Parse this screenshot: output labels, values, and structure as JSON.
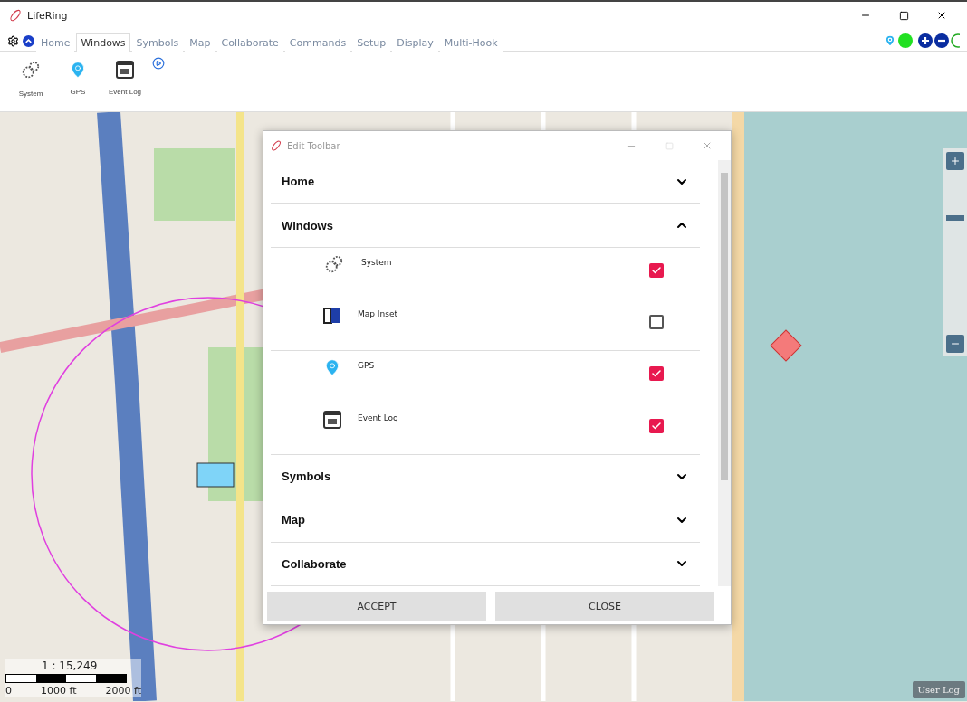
{
  "window": {
    "title": "LifeRing"
  },
  "tabs": [
    {
      "label": "Home",
      "selected": false
    },
    {
      "label": "Windows",
      "selected": true
    },
    {
      "label": "Symbols",
      "selected": false
    },
    {
      "label": "Map",
      "selected": false
    },
    {
      "label": "Collaborate",
      "selected": false
    },
    {
      "label": "Commands",
      "selected": false
    },
    {
      "label": "Setup",
      "selected": false
    },
    {
      "label": "Display",
      "selected": false
    },
    {
      "label": "Multi-Hook",
      "selected": false
    }
  ],
  "ribbon": {
    "items": [
      {
        "kind": "gears",
        "label": "System"
      },
      {
        "kind": "pin",
        "label": "GPS"
      },
      {
        "kind": "log",
        "label": "Event Log"
      }
    ]
  },
  "map": {
    "scale": "1 : 15,249",
    "scale_ticks": [
      "0",
      "1000 ft",
      "2000 ft"
    ],
    "user_log": "User Log",
    "zoom": {
      "level": 0.67
    }
  },
  "dialog": {
    "title": "Edit Toolbar",
    "sections": [
      {
        "title": "Home",
        "expanded": false
      },
      {
        "title": "Windows",
        "expanded": true,
        "items": [
          {
            "kind": "gears",
            "label": "System",
            "checked": true
          },
          {
            "kind": "map",
            "label": "Map Inset",
            "checked": false
          },
          {
            "kind": "pin",
            "label": "GPS",
            "checked": true
          },
          {
            "kind": "log",
            "label": "Event Log",
            "checked": true
          }
        ]
      },
      {
        "title": "Symbols",
        "expanded": false
      },
      {
        "title": "Map",
        "expanded": false
      },
      {
        "title": "Collaborate",
        "expanded": false
      }
    ],
    "buttons": [
      "ACCEPT",
      "CLOSE"
    ]
  }
}
